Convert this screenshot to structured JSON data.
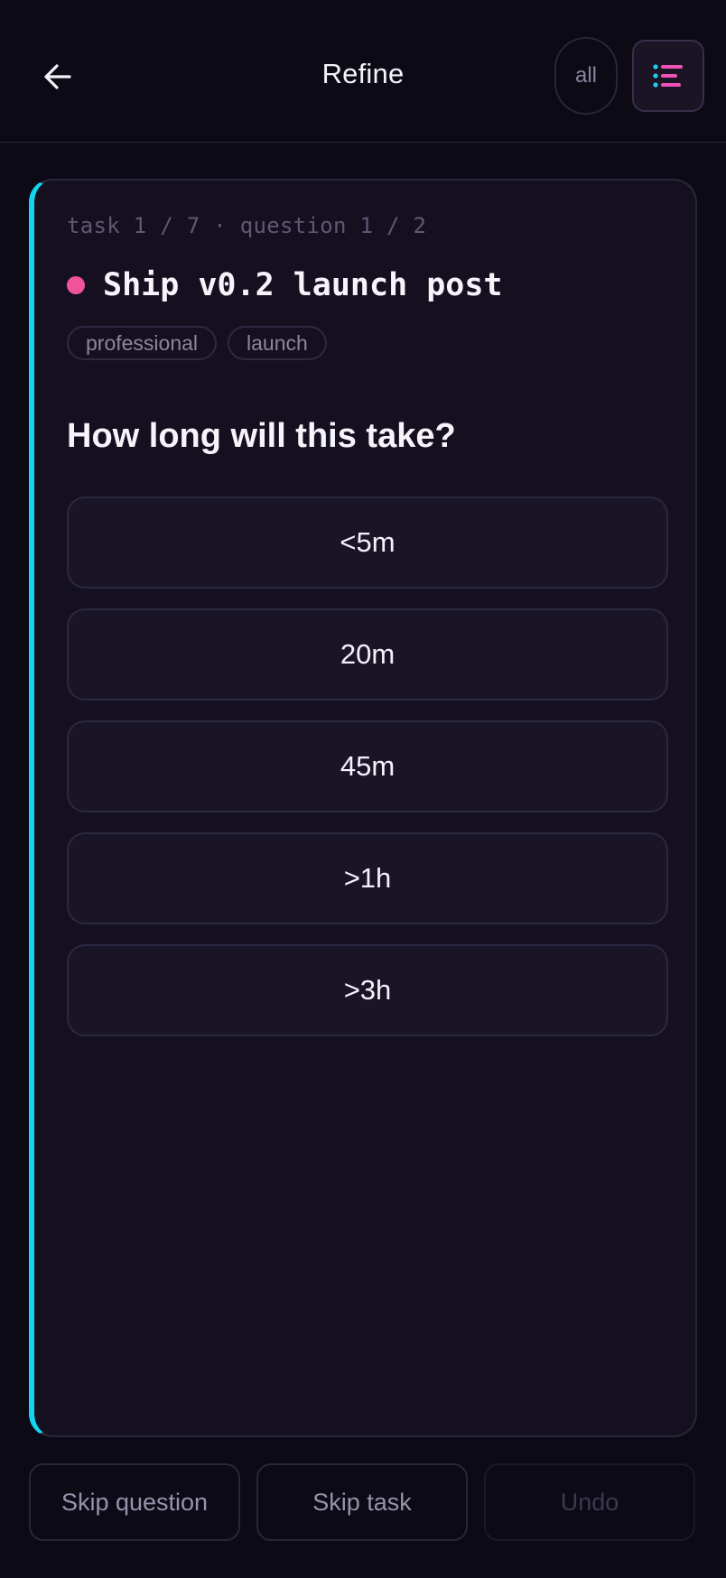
{
  "header": {
    "title": "Refine",
    "back_icon": "arrow-left-icon",
    "filter_label": "all",
    "menu_icon": "list-icon"
  },
  "card": {
    "accent_color": "#13d6ee",
    "meta": "task 1 / 7 · question 1 / 2",
    "task_title": "Ship v0.2 launch post",
    "dot_color": "#f0529c",
    "tags": [
      "professional",
      "launch"
    ],
    "question": "How long will this take?",
    "options": [
      "<5m",
      "20m",
      "45m",
      ">1h",
      ">3h"
    ]
  },
  "footer": {
    "skip_question": "Skip question",
    "skip_task": "Skip task",
    "undo": "Undo"
  }
}
